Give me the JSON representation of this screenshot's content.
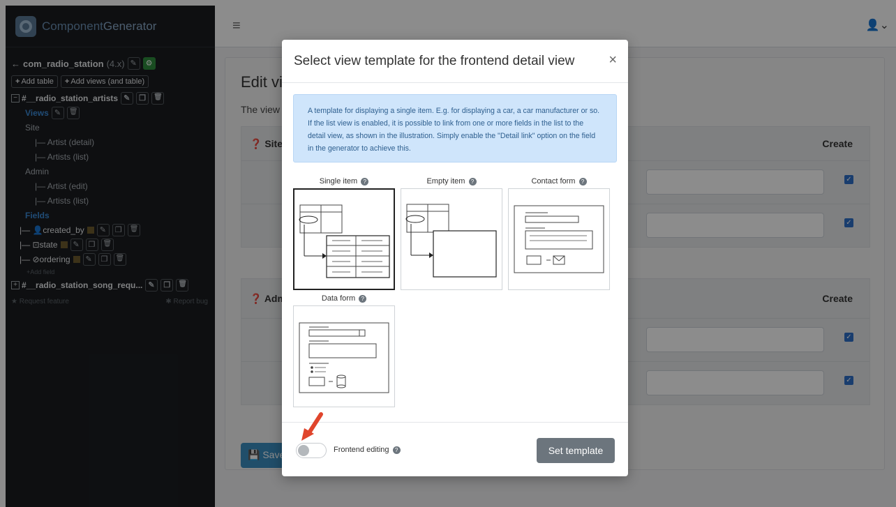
{
  "app": {
    "brand_first": "Component",
    "brand_second": "Generator"
  },
  "sidebar": {
    "component_name": "com_radio_station",
    "component_version": "(4.x)",
    "add_table_label": "Add table",
    "add_views_label": "Add views (and table)",
    "table1_name": "#__radio_station_artists",
    "views_label": "Views",
    "site_label": "Site",
    "site_items": [
      "|— Artist (detail)",
      "|— Artists (list)"
    ],
    "admin_label": "Admin",
    "admin_items": [
      "|— Artist (edit)",
      "|— Artists (list)"
    ],
    "fields_label": "Fields",
    "fields": [
      "created_by",
      "state",
      "ordering"
    ],
    "add_field_label": "+Add field",
    "table2_name": "#__radio_station_song_requ...",
    "request_feature": "Request feature",
    "report_bug": "Report bug"
  },
  "main": {
    "page_title": "Edit vi",
    "intro": "The view",
    "site_panel_title": "Site",
    "admin_panel_title": "Adm",
    "create_header": "Create",
    "save_label": "Save"
  },
  "modal": {
    "title": "Select view template for the frontend detail view",
    "close": "×",
    "info": "A template for displaying a single item. E.g. for displaying a car, a car manufacturer or so. If the list view is enabled, it is possible to link from one or more fields in the list to the detail view, as shown in the illustration. Simply enable the \"Detail link\" option on the field in the generator to achieve this.",
    "templates": [
      {
        "label": "Single item",
        "selected": true
      },
      {
        "label": "Empty item",
        "selected": false
      },
      {
        "label": "Contact form",
        "selected": false
      },
      {
        "label": "Data form",
        "selected": false
      }
    ],
    "frontend_editing_label": "Frontend editing",
    "frontend_editing_enabled": false,
    "set_template_label": "Set template"
  },
  "colors": {
    "sidebar_bg": "#1a1d20",
    "accent_blue": "#3b8ad8",
    "info_bg": "#cfe5fb",
    "button_gray": "#6c757d",
    "arrow_red": "#e0452c"
  }
}
